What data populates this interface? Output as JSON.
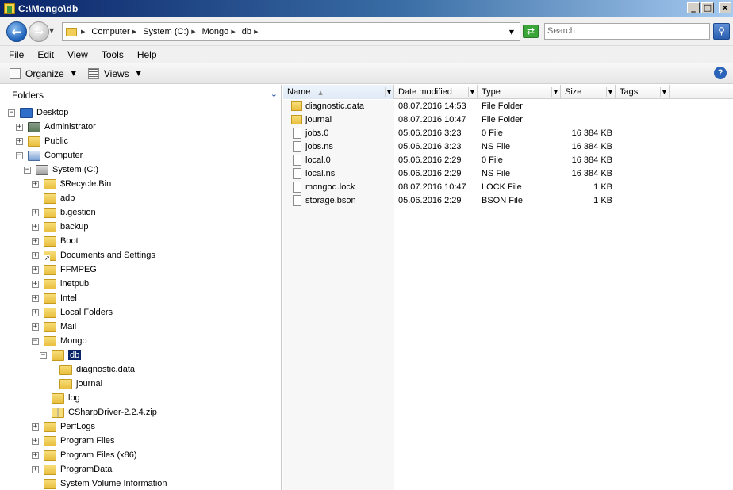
{
  "window": {
    "title": "C:\\Mongo\\db"
  },
  "address": {
    "crumbs": [
      "Computer",
      "System (C:)",
      "Mongo",
      "db"
    ],
    "search_placeholder": "Search"
  },
  "menu": [
    "File",
    "Edit",
    "View",
    "Tools",
    "Help"
  ],
  "toolbar": {
    "organize": "Organize",
    "views": "Views"
  },
  "folders_pane": {
    "title": "Folders",
    "tree": [
      {
        "label": "Desktop",
        "exp": "−",
        "icon": "desktop-icon"
      },
      {
        "label": "Administrator",
        "exp": "+",
        "icon": "user-folder-icon"
      },
      {
        "label": "Public",
        "exp": "+",
        "icon": "folder-icon"
      },
      {
        "label": "Computer",
        "exp": "−",
        "icon": "computer-icon"
      },
      {
        "label": "System (C:)",
        "exp": "−",
        "icon": "drive-icon"
      },
      {
        "label": "$Recycle.Bin",
        "exp": "+",
        "icon": "folder-icon"
      },
      {
        "label": "adb",
        "exp": "",
        "icon": "folder-icon"
      },
      {
        "label": "b.gestion",
        "exp": "+",
        "icon": "folder-icon"
      },
      {
        "label": "backup",
        "exp": "+",
        "icon": "folder-icon"
      },
      {
        "label": "Boot",
        "exp": "+",
        "icon": "folder-icon"
      },
      {
        "label": "Documents and Settings",
        "exp": "+",
        "icon": "shortcut-folder-icon"
      },
      {
        "label": "FFMPEG",
        "exp": "+",
        "icon": "folder-icon"
      },
      {
        "label": "inetpub",
        "exp": "+",
        "icon": "folder-icon"
      },
      {
        "label": "Intel",
        "exp": "+",
        "icon": "folder-icon"
      },
      {
        "label": "Local Folders",
        "exp": "+",
        "icon": "folder-icon"
      },
      {
        "label": "Mail",
        "exp": "+",
        "icon": "folder-icon"
      },
      {
        "label": "Mongo",
        "exp": "−",
        "icon": "folder-icon"
      },
      {
        "label": "db",
        "exp": "−",
        "icon": "folder-icon",
        "selected": true
      },
      {
        "label": "diagnostic.data",
        "exp": "",
        "icon": "folder-icon"
      },
      {
        "label": "journal",
        "exp": "",
        "icon": "folder-icon"
      },
      {
        "label": "log",
        "exp": "",
        "icon": "folder-icon"
      },
      {
        "label": "CSharpDriver-2.2.4.zip",
        "exp": "",
        "icon": "zip-folder-icon"
      },
      {
        "label": "PerfLogs",
        "exp": "+",
        "icon": "folder-icon"
      },
      {
        "label": "Program Files",
        "exp": "+",
        "icon": "folder-icon"
      },
      {
        "label": "Program Files (x86)",
        "exp": "+",
        "icon": "folder-icon"
      },
      {
        "label": "ProgramData",
        "exp": "+",
        "icon": "folder-icon"
      },
      {
        "label": "System Volume Information",
        "exp": "",
        "icon": "folder-icon"
      }
    ]
  },
  "file_list": {
    "columns": [
      "Name",
      "Date modified",
      "Type",
      "Size",
      "Tags"
    ],
    "rows": [
      {
        "name": "diagnostic.data",
        "date": "08.07.2016 14:53",
        "type": "File Folder",
        "size": "",
        "icon": "folder-icon"
      },
      {
        "name": "journal",
        "date": "08.07.2016 10:47",
        "type": "File Folder",
        "size": "",
        "icon": "folder-icon"
      },
      {
        "name": "jobs.0",
        "date": "05.06.2016 3:23",
        "type": "0 File",
        "size": "16 384 KB",
        "icon": "file-icon"
      },
      {
        "name": "jobs.ns",
        "date": "05.06.2016 3:23",
        "type": "NS File",
        "size": "16 384 KB",
        "icon": "file-icon"
      },
      {
        "name": "local.0",
        "date": "05.06.2016 2:29",
        "type": "0 File",
        "size": "16 384 KB",
        "icon": "file-icon"
      },
      {
        "name": "local.ns",
        "date": "05.06.2016 2:29",
        "type": "NS File",
        "size": "16 384 KB",
        "icon": "file-icon"
      },
      {
        "name": "mongod.lock",
        "date": "08.07.2016 10:47",
        "type": "LOCK File",
        "size": "1 KB",
        "icon": "file-icon"
      },
      {
        "name": "storage.bson",
        "date": "05.06.2016 2:29",
        "type": "BSON File",
        "size": "1 KB",
        "icon": "file-icon"
      }
    ]
  },
  "colors": {
    "title_bar_start": "#0a246a",
    "title_bar_end": "#a6caf0",
    "selection": "#0a246a",
    "folder": "#f2cf57"
  }
}
